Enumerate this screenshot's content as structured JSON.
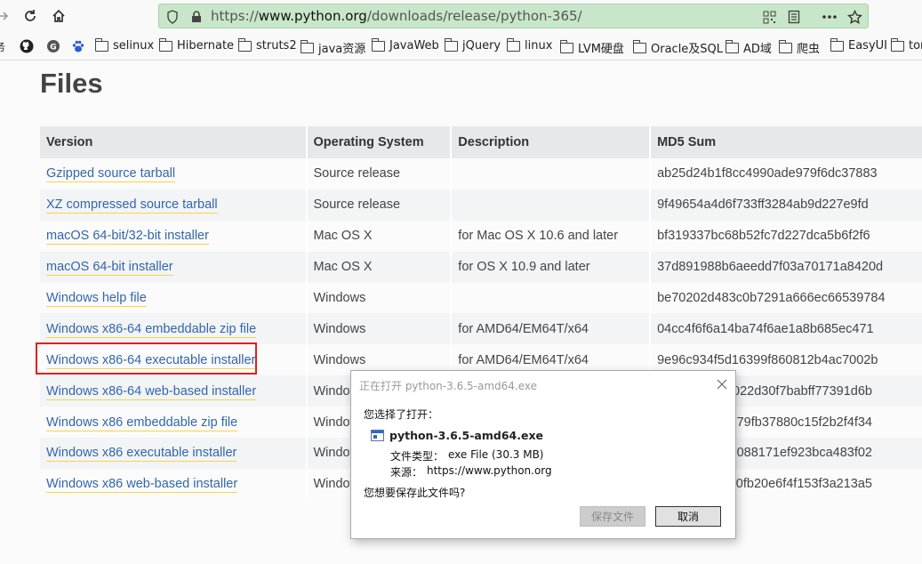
{
  "browser": {
    "url_prefix": "https://",
    "url_host": "www.python.org",
    "url_path": "/downloads/release/python-365/"
  },
  "bookmarks": [
    "selinux",
    "Hibernate",
    "struts2",
    "java资源",
    "JavaWeb",
    "jQuery",
    "linux",
    "LVM硬盘",
    "Oracle及SQL",
    "AD域",
    "爬虫",
    "EasyUI",
    "tom"
  ],
  "page": {
    "title": "Files",
    "table": {
      "headers": [
        "Version",
        "Operating System",
        "Description",
        "MD5 Sum"
      ],
      "rows": [
        {
          "version": "Gzipped source tarball",
          "os": "Source release",
          "desc": "",
          "md5": "ab25d24b1f8cc4990ade979f6dc37883"
        },
        {
          "version": "XZ compressed source tarball",
          "os": "Source release",
          "desc": "",
          "md5": "9f49654a4d6f733ff3284ab9d227e9fd"
        },
        {
          "version": "macOS 64-bit/32-bit installer",
          "os": "Mac OS X",
          "desc": "for Mac OS X 10.6 and later",
          "md5": "bf319337bc68b52fc7d227dca5b6f2f6"
        },
        {
          "version": "macOS 64-bit installer",
          "os": "Mac OS X",
          "desc": "for OS X 10.9 and later",
          "md5": "37d891988b6aeedd7f03a70171a8420d"
        },
        {
          "version": "Windows help file",
          "os": "Windows",
          "desc": "",
          "md5": "be70202d483c0b7291a666ec66539784"
        },
        {
          "version": "Windows x86-64 embeddable zip file",
          "os": "Windows",
          "desc": "for AMD64/EM64T/x64",
          "md5": "04cc4f6f6a14ba74f6ae1a8b685ec471"
        },
        {
          "version": "Windows x86-64 executable installer",
          "os": "Windows",
          "desc": "for AMD64/EM64T/x64",
          "md5": "9e96c934f5d16399f860812b4ac7002b"
        },
        {
          "version": "Windows x86-64 web-based installer",
          "os": "Window",
          "desc": "",
          "md5": "022d30f7babff77391d6b"
        },
        {
          "version": "Windows x86 embeddable zip file",
          "os": "Window",
          "desc": "",
          "md5": "79fb37880c15f2b2f4f34"
        },
        {
          "version": "Windows x86 executable installer",
          "os": "Window",
          "desc": "",
          "md5": "5088171ef923bca483f02"
        },
        {
          "version": "Windows x86 web-based installer",
          "os": "Window",
          "desc": "",
          "md5": "0fb20e6f4f153f3a213a5"
        }
      ]
    }
  },
  "dialog": {
    "title": "正在打开 python-3.6.5-amd64.exe",
    "you_chose": "您选择了打开：",
    "filename": "python-3.6.5-amd64.exe",
    "filetype_label": "文件类型：",
    "filetype_value": "exe File (30.3 MB)",
    "source_label": "来源：",
    "source_value": "https://www.python.org",
    "question": "您想要保存此文件吗?",
    "save_label": "保存文件",
    "cancel_label": "取消"
  }
}
